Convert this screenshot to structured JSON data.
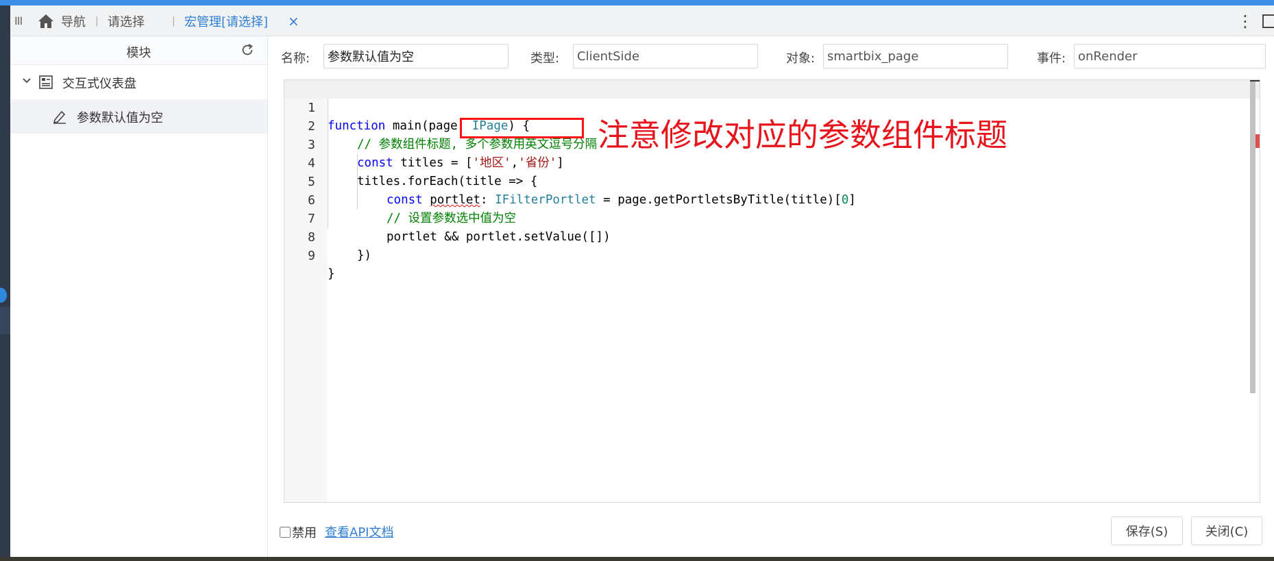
{
  "tabbar": {
    "menu_glyph": "III",
    "home_label": "导航",
    "select_label": "请选择",
    "active_tab": "宏管理[请选择]",
    "close_glyph": "×",
    "more_glyph": "⋮"
  },
  "sidebar": {
    "title": "模块",
    "tree": {
      "group_label": "交互式仪表盘",
      "item_label": "参数默认值为空"
    }
  },
  "form": {
    "name_label": "名称:",
    "name_value": "参数默认值为空",
    "type_label": "类型:",
    "type_value": "ClientSide",
    "object_label": "对象:",
    "object_value": "smartbix_page",
    "event_label": "事件:",
    "event_value": "onRender"
  },
  "editor": {
    "line_numbers": [
      "1",
      "2",
      "3",
      "4",
      "5",
      "6",
      "7",
      "8",
      "9"
    ],
    "l1": {
      "kw": "function",
      "a": " main(page: ",
      "ty": "IPage",
      "b": ") {"
    },
    "l2": {
      "cm": "// 参数组件标题, 多个参数用英文逗号分隔"
    },
    "l3": {
      "kw": "const",
      "a": " titles = [",
      "s1": "'地区'",
      "c": ",",
      "s2": "'省份'",
      "b": "]"
    },
    "l4": {
      "a": "titles.forEach(title => {"
    },
    "l5": {
      "kw": "const",
      "sp": " ",
      "sq": "portlet",
      "a": ": ",
      "ty": "IFilterPortlet",
      "b": " = page.getPortletsByTitle(title)[",
      "num": "0",
      "e": "]"
    },
    "l6": {
      "cm": "// 设置参数选中值为空"
    },
    "l7": {
      "a": "portlet && portlet.setValue([])"
    },
    "l8": {
      "a": "})"
    },
    "l9": {
      "a": "}"
    }
  },
  "annotation": "注意修改对应的参数组件标题",
  "footer": {
    "disable_label": "禁用",
    "api_link": "查看API文档",
    "save_button": "保存(S)",
    "close_button": "关闭(C)"
  },
  "colors": {
    "accent": "#3d8ee6",
    "link": "#2f7fd5",
    "annotation": "#e8141b"
  }
}
